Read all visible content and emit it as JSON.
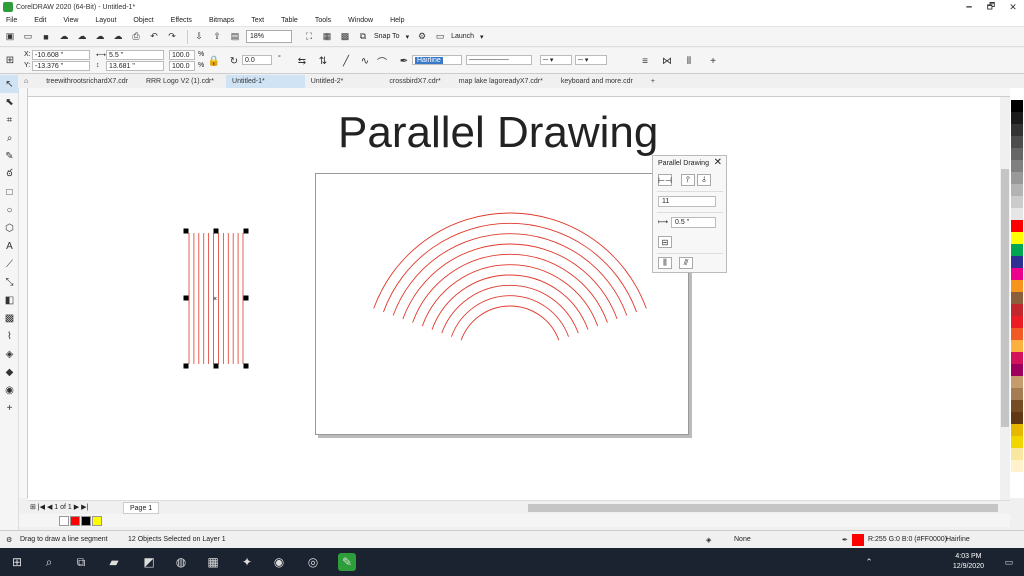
{
  "window": {
    "title": "CorelDRAW 2020 (64-Bit) - Untitled-1*",
    "controls": [
      "🗕",
      "🗗",
      "✕"
    ]
  },
  "menu": [
    "File",
    "Edit",
    "View",
    "Layout",
    "Object",
    "Effects",
    "Bitmaps",
    "Text",
    "Table",
    "Tools",
    "Window",
    "Help"
  ],
  "toolbar": {
    "zoom": "18%",
    "snap_to": "Snap To",
    "launch": "Launch"
  },
  "property_bar": {
    "x": "-10.608 \"",
    "y": "-13.376 \"",
    "width": "5.5 \"",
    "height": "13.681 \"",
    "scale_w": "100.0",
    "scale_h": "100.0",
    "percent": "%",
    "angle": "0.0",
    "outline_width": "Hairline"
  },
  "doc_tabs": [
    {
      "label": "treewithrootsrichardX7.cdr",
      "active": false
    },
    {
      "label": "RRR Logo V2 (1).cdr*",
      "active": false
    },
    {
      "label": "Untitled-1*",
      "active": true
    },
    {
      "label": "Untitled-2*",
      "active": false
    },
    {
      "label": "crossbirdX7.cdr*",
      "active": false
    },
    {
      "label": "map lake lagoreadyX7.cdr*",
      "active": false
    },
    {
      "label": "keyboard and more.cdr",
      "active": false
    }
  ],
  "canvas": {
    "headline": "Parallel Drawing",
    "line_color": "#e0382a",
    "parallel_line_count": 12,
    "arc_count": 10
  },
  "docker": {
    "title": "Parallel Drawing",
    "count_value": "11",
    "distance_value": "0.5 \""
  },
  "page_nav": {
    "page_label": "Page 1",
    "controls": "⊞ |◀ ◀ 1 of 1 ▶ ▶|"
  },
  "status": {
    "hint": "Drag to draw a line segment",
    "selection": "12 Objects Selected on Layer 1",
    "fill": "None",
    "outline_color_text": "R:255 G:0 B:0 (#FF0000)",
    "outline_width": "Hairline"
  },
  "palette": [
    "#ffffff",
    "#000000",
    "#1a1a1a",
    "#333333",
    "#4d4d4d",
    "#666666",
    "#808080",
    "#999999",
    "#b3b3b3",
    "#cccccc",
    "#e6e6e6",
    "#ff0000",
    "#ffff00",
    "#00a651",
    "#2e3192",
    "#ec008c",
    "#f7941d",
    "#8b5e3c",
    "#c1272d",
    "#ed1c24",
    "#f15a24",
    "#fbb040",
    "#d4145a",
    "#9e005d",
    "#c69c6d",
    "#a67c52",
    "#754c24",
    "#603813",
    "#e6b800",
    "#f2d600",
    "#f9e79f",
    "#fff2cc"
  ],
  "doc_palette": [
    "#ffffff",
    "#ff0000",
    "#000000",
    "#ffff00"
  ],
  "taskbar": {
    "time": "4:03 PM",
    "date": "12/9/2020"
  }
}
